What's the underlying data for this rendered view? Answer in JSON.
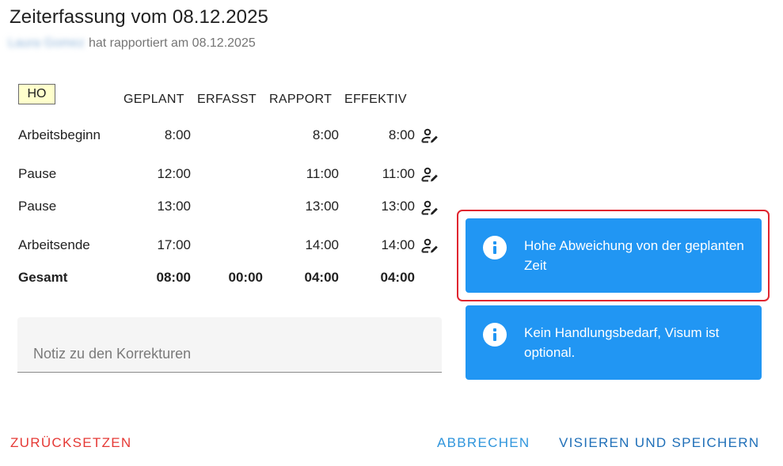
{
  "header": {
    "title": "Zeiterfassung vom 08.12.2025",
    "user_name": "Laura Gomez",
    "reported_text": "hat rapportiert am 08.12.2025"
  },
  "badge": "HO",
  "table": {
    "columns": [
      "GEPLANT",
      "ERFASST",
      "RAPPORT",
      "EFFEKTIV"
    ],
    "rows": [
      {
        "label": "Arbeitsbeginn",
        "geplant": "8:00",
        "erfasst": "",
        "rapport": "8:00",
        "effektiv": "8:00",
        "edit_icon": "person-edit-icon"
      },
      {
        "label": "Pause",
        "geplant": "12:00",
        "erfasst": "",
        "rapport": "11:00",
        "effektiv": "11:00",
        "edit_icon": "person-edit-icon"
      },
      {
        "label": "Pause",
        "geplant": "13:00",
        "erfasst": "",
        "rapport": "13:00",
        "effektiv": "13:00",
        "edit_icon": "person-edit-icon"
      },
      {
        "label": "Arbeitsende",
        "geplant": "17:00",
        "erfasst": "",
        "rapport": "14:00",
        "effektiv": "14:00",
        "edit_icon": "person-edit-icon"
      }
    ],
    "total": {
      "label": "Gesamt",
      "geplant": "08:00",
      "erfasst": "00:00",
      "rapport": "04:00",
      "effektiv": "04:00"
    }
  },
  "note": {
    "placeholder": "Notiz zu den Korrekturen",
    "value": ""
  },
  "alerts": [
    {
      "icon": "info-icon",
      "text": "Hohe Abweichung von der geplanten Zeit",
      "highlighted": true
    },
    {
      "icon": "info-icon",
      "text": "Kein Handlungsbedarf, Visum ist optional.",
      "highlighted": false
    }
  ],
  "actions": {
    "reset": "ZURÜCKSETZEN",
    "cancel": "ABBRECHEN",
    "approve_save": "VISIEREN UND SPEICHERN"
  },
  "colors": {
    "alert_bg": "#2196f3",
    "highlight_border": "#e0252f",
    "reset_text": "#e53935",
    "primary_text": "#1e88e5",
    "badge_bg": "#ffffcc"
  }
}
